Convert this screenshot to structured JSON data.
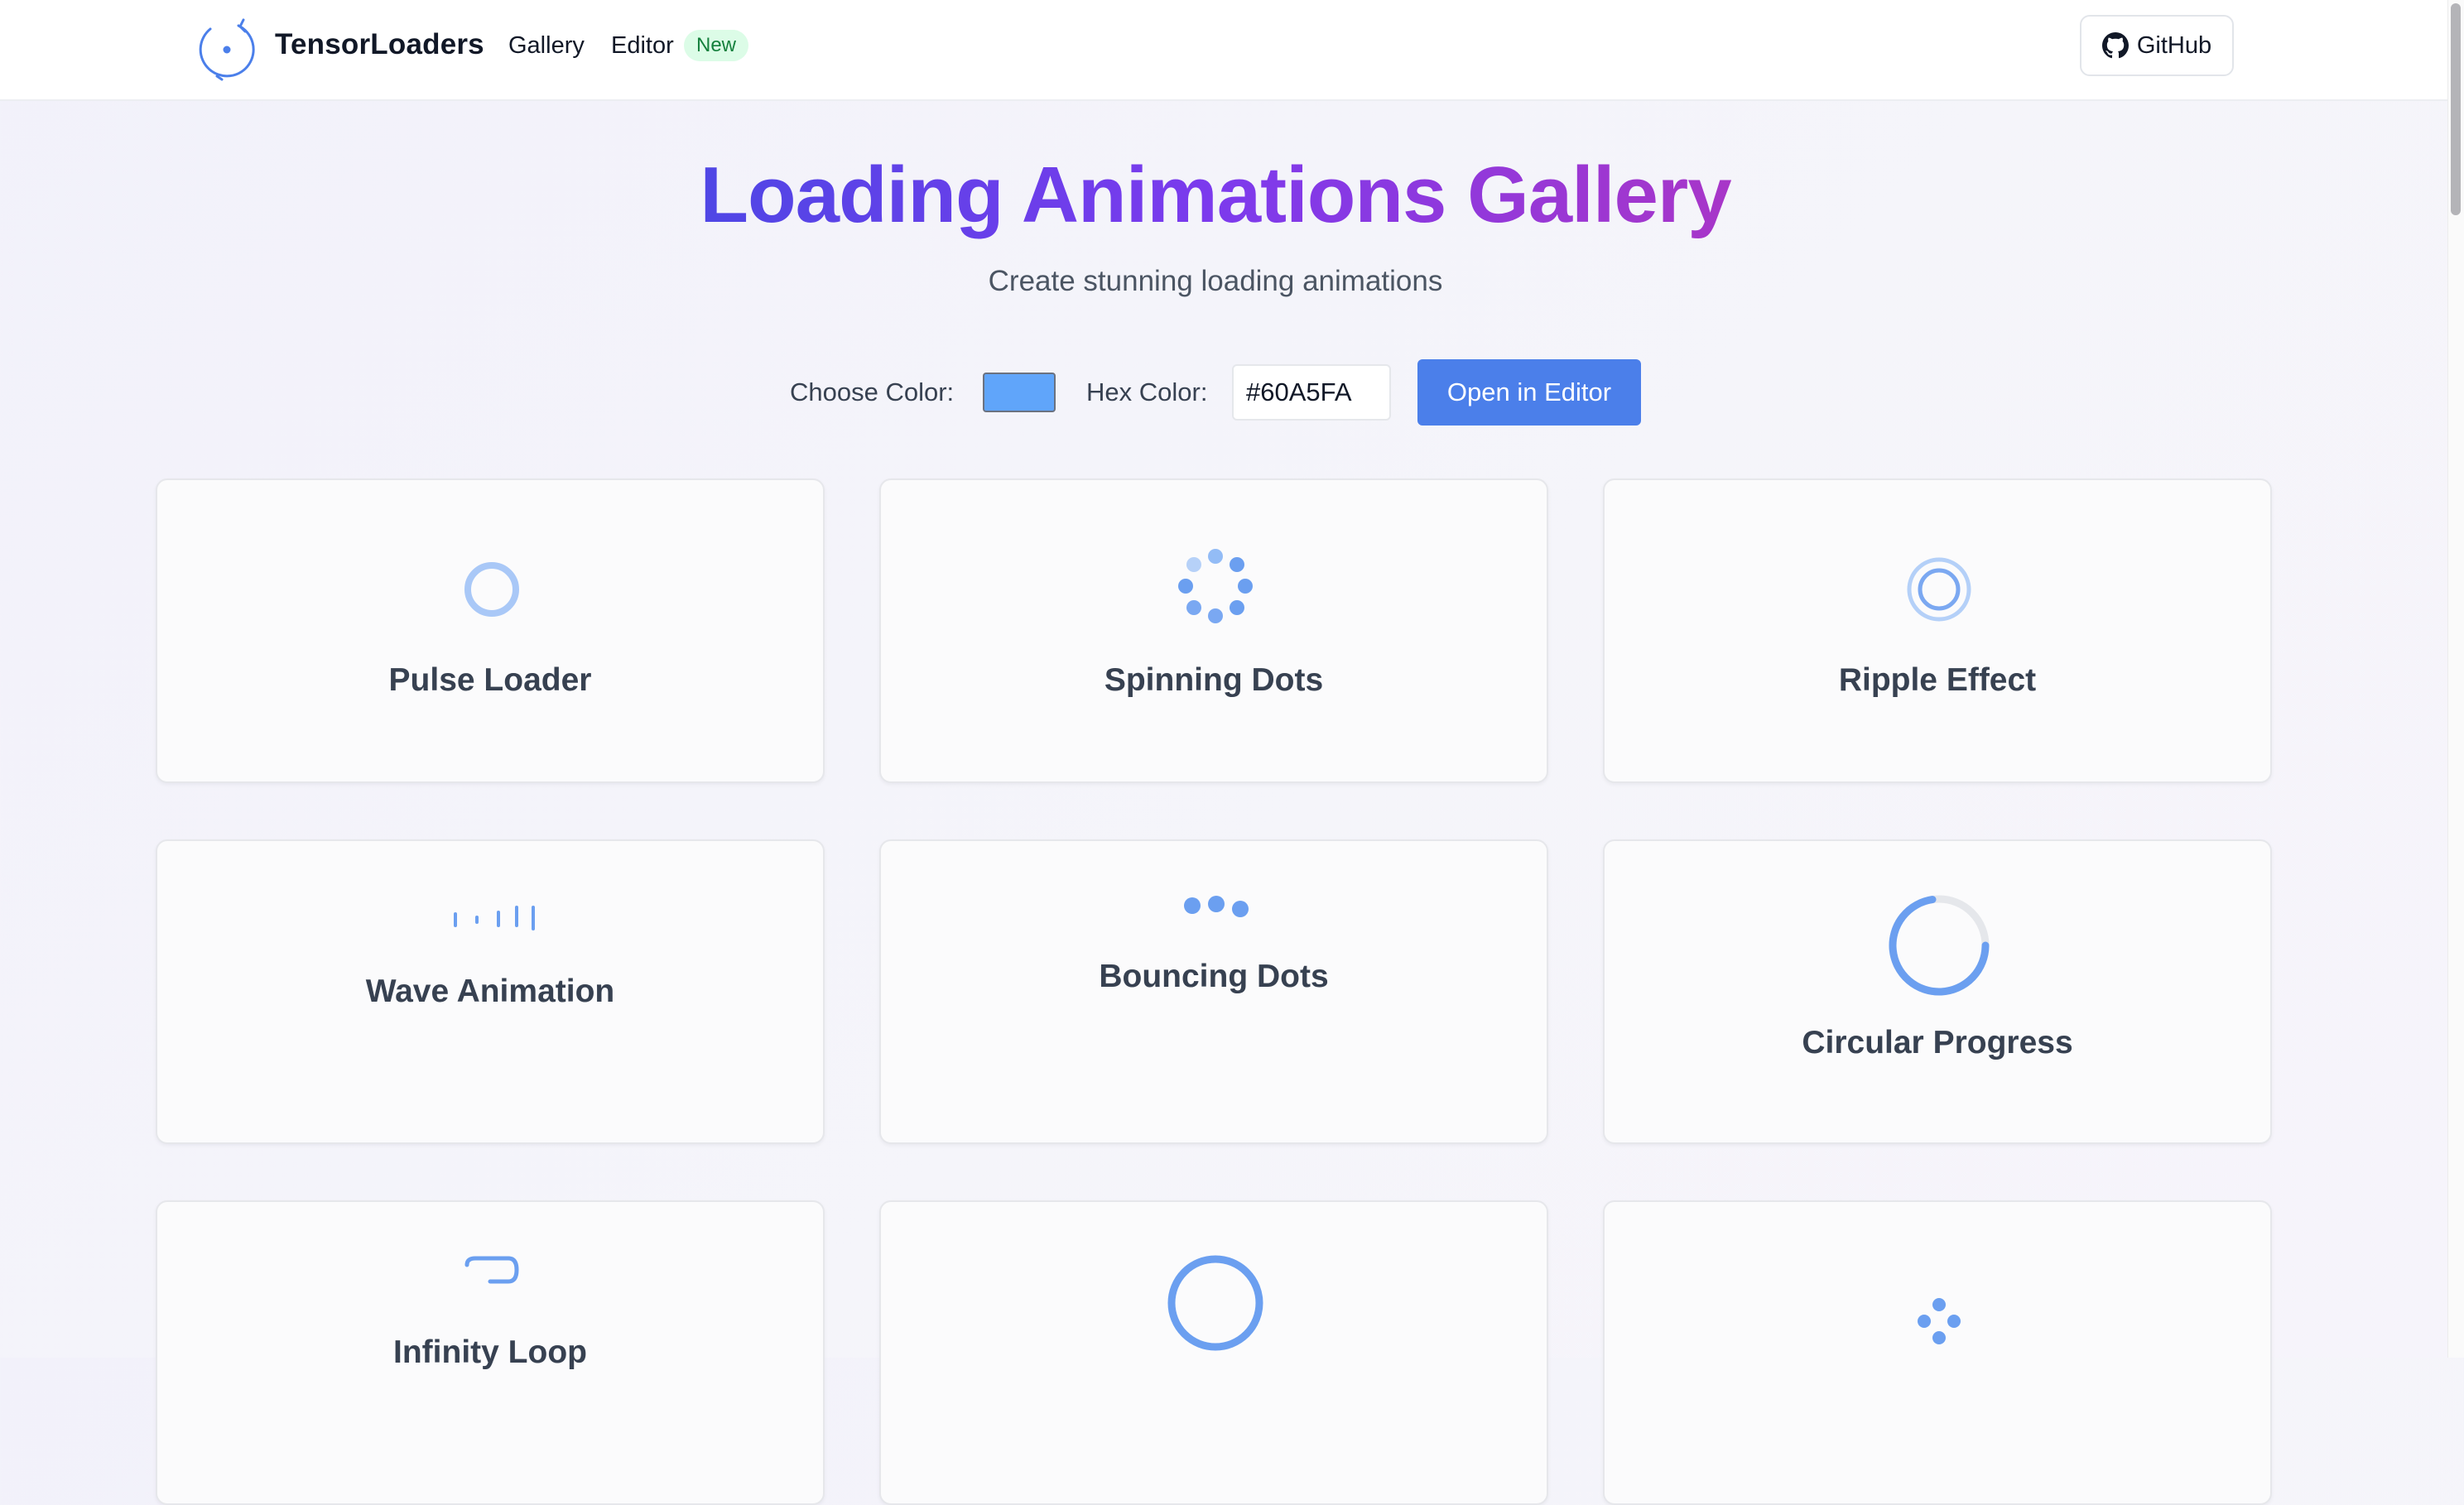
{
  "header": {
    "brand": "TensorLoaders",
    "nav": {
      "gallery": "Gallery",
      "editor": "Editor",
      "editor_badge": "New"
    },
    "github_label": "GitHub"
  },
  "hero": {
    "title": "Loading Animations Gallery",
    "subtitle": "Create stunning loading animations"
  },
  "controls": {
    "choose_color_label": "Choose Color:",
    "color_value": "#60A5FA",
    "hex_color_label": "Hex Color:",
    "hex_value": "#60A5FA",
    "open_editor_label": "Open in Editor"
  },
  "cards": [
    {
      "title": "Pulse Loader"
    },
    {
      "title": "Spinning Dots"
    },
    {
      "title": "Ripple Effect"
    },
    {
      "title": "Wave Animation"
    },
    {
      "title": "Bouncing Dots"
    },
    {
      "title": "Circular Progress"
    },
    {
      "title": "Infinity Loop"
    },
    {
      "title": ""
    },
    {
      "title": ""
    }
  ],
  "colors": {
    "accent": "#60A5FA",
    "button": "#4B7FEA",
    "title_gradient_start": "#4F46E5",
    "title_gradient_end": "#A836C8",
    "badge_bg": "#DCFCE7",
    "badge_text": "#15803D"
  },
  "icons": {
    "logo": "loader-logo-icon",
    "github": "github-icon"
  }
}
